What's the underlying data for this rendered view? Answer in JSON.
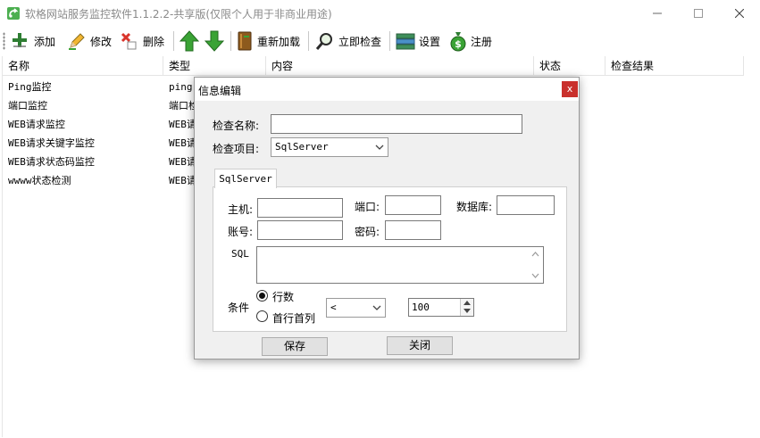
{
  "window": {
    "title": "软格网站服务监控软件1.1.2.2-共享版(仅限个人用于非商业用途)"
  },
  "toolbar": {
    "add_label": "添加",
    "edit_label": "修改",
    "delete_label": "删除",
    "reload_label": "重新加载",
    "check_now_label": "立即检查",
    "settings_label": "设置",
    "register_label": "注册"
  },
  "grid": {
    "columns": [
      "名称",
      "类型",
      "内容",
      "状态",
      "检查结果"
    ],
    "rows": [
      {
        "name": "Ping监控",
        "type": "ping"
      },
      {
        "name": "端口监控",
        "type": "端口检"
      },
      {
        "name": "WEB请求监控",
        "type": "WEB请"
      },
      {
        "name": "WEB请求关键字监控",
        "type": "WEB请"
      },
      {
        "name": "WEB请求状态码监控",
        "type": "WEB请"
      },
      {
        "name": "wwww状态检测",
        "type": "WEB请"
      }
    ]
  },
  "dialog": {
    "title": "信息编辑",
    "close_label": "x",
    "check_name_label": "检查名称:",
    "check_name_value": "",
    "check_item_label": "检查项目:",
    "check_item_value": "SqlServer",
    "tab_label": "SqlServer",
    "host_label": "主机:",
    "host_value": "",
    "port_label": "端口:",
    "port_value": "",
    "database_label": "数据库:",
    "database_value": "",
    "account_label": "账号:",
    "account_value": "",
    "password_label": "密码:",
    "password_value": "",
    "sql_label": "SQL",
    "condition_label": "条件",
    "radio_rows_label": "行数",
    "radio_first_label": "首行首列",
    "operator_value": "<",
    "threshold_value": "100",
    "save_label": "保存",
    "close_button_label": "关闭"
  },
  "colors": {
    "dialog_close_bg": "#c9302c",
    "icon_green": "#3aa335",
    "icon_red": "#d9342b"
  }
}
